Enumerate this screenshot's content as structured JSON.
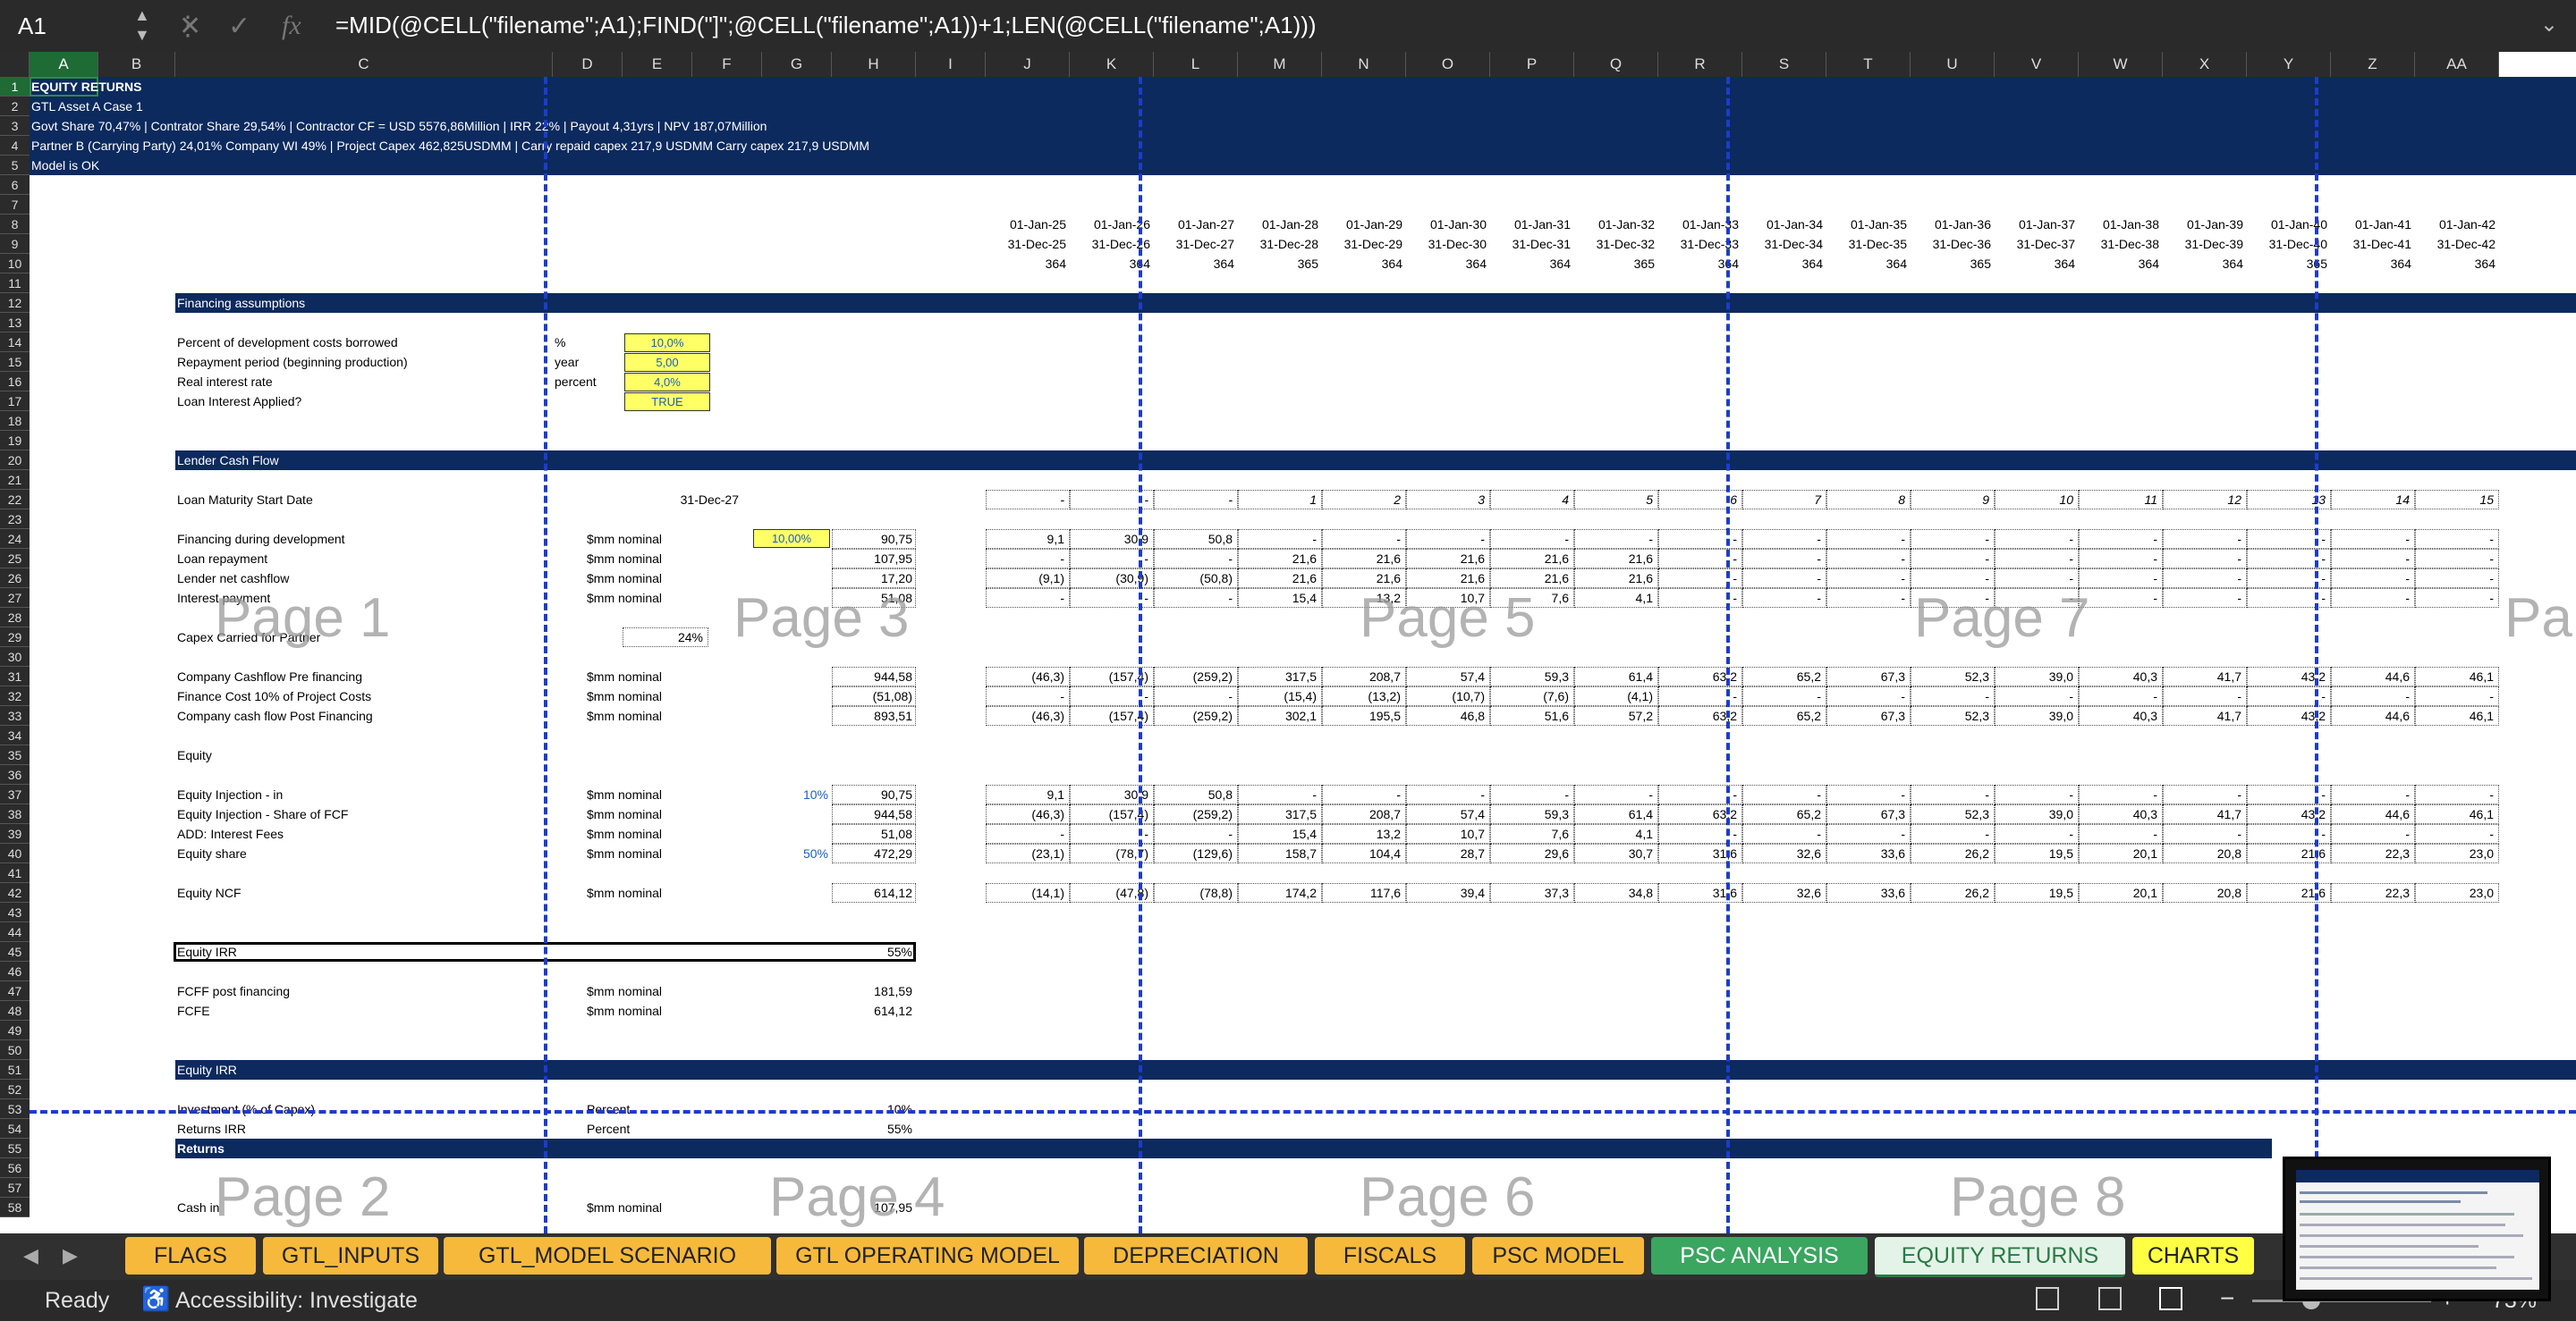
{
  "formula_bar": {
    "cell_ref": "A1",
    "formula": "=MID(@CELL(\"filename\";A1);FIND(\"]\";@CELL(\"filename\";A1))+1;LEN(@CELL(\"filename\";A1)))"
  },
  "columns": [
    "A",
    "B",
    "C",
    "D",
    "E",
    "F",
    "G",
    "H",
    "I",
    "J",
    "K",
    "L",
    "M",
    "N",
    "O",
    "P",
    "Q",
    "R",
    "S",
    "T",
    "U",
    "V",
    "W",
    "X",
    "Y",
    "Z",
    "AA"
  ],
  "rows": [
    "1",
    "2",
    "3",
    "4",
    "5",
    "6",
    "7",
    "8",
    "9",
    "10",
    "11",
    "12",
    "13",
    "14",
    "15",
    "16",
    "17",
    "18",
    "19",
    "20",
    "21",
    "22",
    "23",
    "24",
    "25",
    "26",
    "27",
    "28",
    "29",
    "30",
    "31",
    "32",
    "33",
    "34",
    "35",
    "36",
    "37",
    "38",
    "39",
    "40",
    "41",
    "42",
    "43",
    "44",
    "45",
    "46",
    "47",
    "48",
    "49",
    "50",
    "51",
    "52",
    "53",
    "54",
    "55",
    "56",
    "57",
    "58"
  ],
  "header_block": {
    "title": "EQUITY RETURNS",
    "line2": "GTL Asset A Case 1",
    "line3": "Govt Share 70,47% | Contrator Share 29,54% |  Contractor CF = USD 5576,86Million | IRR 22% | Payout 4,31yrs | NPV 187,07Million",
    "line4": "Partner B (Carrying Party) 24,01% Company WI 49% |  Project Capex 462,825USDMM  |  Carry repaid capex 217,9 USDMM Carry capex 217,9 USDMM",
    "line5": "Model is OK"
  },
  "timeline": {
    "start_dates": [
      "01-Jan-25",
      "01-Jan-26",
      "01-Jan-27",
      "01-Jan-28",
      "01-Jan-29",
      "01-Jan-30",
      "01-Jan-31",
      "01-Jan-32",
      "01-Jan-33",
      "01-Jan-34",
      "01-Jan-35",
      "01-Jan-36",
      "01-Jan-37",
      "01-Jan-38",
      "01-Jan-39",
      "01-Jan-40",
      "01-Jan-41",
      "01-Jan-42"
    ],
    "end_dates": [
      "31-Dec-25",
      "31-Dec-26",
      "31-Dec-27",
      "31-Dec-28",
      "31-Dec-29",
      "31-Dec-30",
      "31-Dec-31",
      "31-Dec-32",
      "31-Dec-33",
      "31-Dec-34",
      "31-Dec-35",
      "31-Dec-36",
      "31-Dec-37",
      "31-Dec-38",
      "31-Dec-39",
      "31-Dec-40",
      "31-Dec-41",
      "31-Dec-42"
    ],
    "days": [
      "364",
      "364",
      "364",
      "365",
      "364",
      "364",
      "364",
      "365",
      "364",
      "364",
      "364",
      "365",
      "364",
      "364",
      "364",
      "365",
      "364",
      "364"
    ]
  },
  "sections": {
    "financing": "Financing assumptions",
    "lender": "Lender Cash Flow",
    "equity_irr": "Equity IRR",
    "returns": "Returns"
  },
  "financing_assumptions": [
    {
      "label": "Percent of development costs borrowed",
      "unit": "%",
      "value": "10,0%"
    },
    {
      "label": "Repayment period (beginning production)",
      "unit": "year",
      "value": "5,00"
    },
    {
      "label": "Real interest rate",
      "unit": "percent",
      "value": "4,0%"
    },
    {
      "label": "Loan Interest Applied?",
      "unit": "",
      "value": "TRUE"
    }
  ],
  "loan_maturity": {
    "label": "Loan Maturity Start Date",
    "value": "31-Dec-27",
    "periods": [
      "-",
      "-",
      "-",
      "1",
      "2",
      "3",
      "4",
      "5",
      "6",
      "7",
      "8",
      "9",
      "10",
      "11",
      "12",
      "13",
      "14",
      "15"
    ]
  },
  "lender_rows": [
    {
      "label": "Financing during development",
      "unit": "$mm nominal",
      "rate": "10,00%",
      "total": "90,75",
      "values": [
        "9,1",
        "30,9",
        "50,8",
        "-",
        "-",
        "-",
        "-",
        "-",
        "-",
        "-",
        "-",
        "-",
        "-",
        "-",
        "-",
        "-",
        "-",
        "-"
      ]
    },
    {
      "label": "Loan repayment",
      "unit": "$mm nominal",
      "rate": "",
      "total": "107,95",
      "values": [
        "-",
        "-",
        "-",
        "21,6",
        "21,6",
        "21,6",
        "21,6",
        "21,6",
        "-",
        "-",
        "-",
        "-",
        "-",
        "-",
        "-",
        "-",
        "-",
        "-"
      ]
    },
    {
      "label": "Lender net cashflow",
      "unit": "$mm nominal",
      "rate": "",
      "total": "17,20",
      "values": [
        "(9,1)",
        "(30,9)",
        "(50,8)",
        "21,6",
        "21,6",
        "21,6",
        "21,6",
        "21,6",
        "-",
        "-",
        "-",
        "-",
        "-",
        "-",
        "-",
        "-",
        "-",
        "-"
      ]
    },
    {
      "label": "Interest payment",
      "unit": "$mm nominal",
      "rate": "",
      "total": "51,08",
      "values": [
        "-",
        "-",
        "-",
        "15,4",
        "13,2",
        "10,7",
        "7,6",
        "4,1",
        "-",
        "-",
        "-",
        "-",
        "-",
        "-",
        "-",
        "-",
        "-",
        "-"
      ]
    }
  ],
  "capex_carried": {
    "label": "Capex Carried for Partner",
    "value": "24%"
  },
  "company_rows": [
    {
      "label": "Company Cashflow Pre financing",
      "unit": "$mm nominal",
      "total": "944,58",
      "values": [
        "(46,3)",
        "(157,4)",
        "(259,2)",
        "317,5",
        "208,7",
        "57,4",
        "59,3",
        "61,4",
        "63,2",
        "65,2",
        "67,3",
        "52,3",
        "39,0",
        "40,3",
        "41,7",
        "43,2",
        "44,6",
        "46,1"
      ]
    },
    {
      "label": "Finance Cost 10% of Project Costs",
      "unit": "$mm nominal",
      "total": "(51,08)",
      "values": [
        "-",
        "-",
        "-",
        "(15,4)",
        "(13,2)",
        "(10,7)",
        "(7,6)",
        "(4,1)",
        "-",
        "-",
        "-",
        "-",
        "-",
        "-",
        "-",
        "-",
        "-",
        "-"
      ]
    },
    {
      "label": "Company cash flow Post Financing",
      "unit": "$mm nominal",
      "total": "893,51",
      "values": [
        "(46,3)",
        "(157,4)",
        "(259,2)",
        "302,1",
        "195,5",
        "46,8",
        "51,6",
        "57,2",
        "63,2",
        "65,2",
        "67,3",
        "52,3",
        "39,0",
        "40,3",
        "41,7",
        "43,2",
        "44,6",
        "46,1"
      ]
    }
  ],
  "equity_label": "Equity",
  "equity_rows": [
    {
      "label": "Equity Injection - in",
      "unit": "$mm nominal",
      "pct": "10%",
      "total": "90,75",
      "values": [
        "9,1",
        "30,9",
        "50,8",
        "-",
        "-",
        "-",
        "-",
        "-",
        "-",
        "-",
        "-",
        "-",
        "-",
        "-",
        "-",
        "-",
        "-",
        "-"
      ]
    },
    {
      "label": "Equity Injection - Share of FCF",
      "unit": "$mm nominal",
      "pct": "",
      "total": "944,58",
      "values": [
        "(46,3)",
        "(157,4)",
        "(259,2)",
        "317,5",
        "208,7",
        "57,4",
        "59,3",
        "61,4",
        "63,2",
        "65,2",
        "67,3",
        "52,3",
        "39,0",
        "40,3",
        "41,7",
        "43,2",
        "44,6",
        "46,1"
      ]
    },
    {
      "label": "ADD: Interest Fees",
      "unit": "$mm nominal",
      "pct": "",
      "total": "51,08",
      "values": [
        "-",
        "-",
        "-",
        "15,4",
        "13,2",
        "10,7",
        "7,6",
        "4,1",
        "-",
        "-",
        "-",
        "-",
        "-",
        "-",
        "-",
        "-",
        "-",
        "-"
      ]
    },
    {
      "label": "Equity share",
      "unit": "$mm nominal",
      "pct": "50%",
      "total": "472,29",
      "values": [
        "(23,1)",
        "(78,7)",
        "(129,6)",
        "158,7",
        "104,4",
        "28,7",
        "29,6",
        "30,7",
        "31,6",
        "32,6",
        "33,6",
        "26,2",
        "19,5",
        "20,1",
        "20,8",
        "21,6",
        "22,3",
        "23,0"
      ]
    }
  ],
  "equity_ncf": {
    "label": "Equity NCF",
    "unit": "$mm nominal",
    "total": "614,12",
    "values": [
      "(14,1)",
      "(47,8)",
      "(78,8)",
      "174,2",
      "117,6",
      "39,4",
      "37,3",
      "34,8",
      "31,6",
      "32,6",
      "33,6",
      "26,2",
      "19,5",
      "20,1",
      "20,8",
      "21,6",
      "22,3",
      "23,0"
    ]
  },
  "equity_irr_row": {
    "label": "Equity IRR",
    "value": "55%"
  },
  "post_rows": [
    {
      "label": "FCFF post financing",
      "unit": "$mm nominal",
      "value": "181,59"
    },
    {
      "label": "FCFE",
      "unit": "$mm nominal",
      "value": "614,12"
    }
  ],
  "irr_rows": [
    {
      "label": "Investment (% of Capex)",
      "unit": "Percent",
      "value": "10%"
    },
    {
      "label": "Returns IRR",
      "unit": "Percent",
      "value": "55%"
    }
  ],
  "cash_in": {
    "label": "Cash in",
    "unit": "$mm nominal",
    "value": "107,95"
  },
  "page_watermarks": [
    "Page 1",
    "Page 3",
    "Page 5",
    "Page 7",
    "Pa",
    "Page 2",
    "Page 4",
    "Page 6",
    "Page 8"
  ],
  "sheet_tabs": [
    "FLAGS",
    "GTL_INPUTS",
    "GTL_MODEL SCENARIO",
    "GTL OPERATING MODEL",
    "DEPRECIATION",
    "FISCALS",
    "PSC MODEL",
    "PSC ANALYSIS",
    "EQUITY RETURNS",
    "CHARTS"
  ],
  "status": {
    "ready": "Ready",
    "accessibility": "Accessibility: Investigate",
    "zoom": "73%"
  },
  "colors": {
    "header_navy": "#0c2a5e",
    "tab_orange": "#f6b93b",
    "tab_green": "#3aa660",
    "tab_active": "#e4f3e8",
    "tab_yellow": "#ffff44",
    "page_break": "#1e3cc8"
  }
}
